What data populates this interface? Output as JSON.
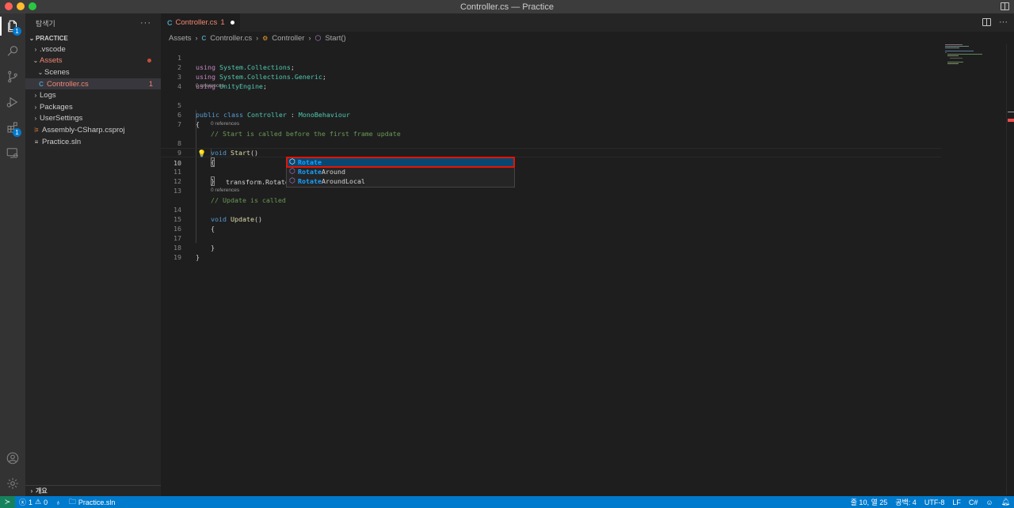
{
  "window": {
    "title": "Controller.cs — Practice"
  },
  "traffic_lights": {
    "close": "#ff5f57",
    "minimize": "#febc2e",
    "maximize": "#28c840"
  },
  "activity_bar": {
    "explorer_badge": "1",
    "extensions_badge": "1"
  },
  "sidebar": {
    "header": "탐색기",
    "more": "···",
    "section": "PRACTICE",
    "items": [
      {
        "label": ".vscode",
        "chevron": "›",
        "color": "#cccccc"
      },
      {
        "label": "Assets",
        "chevron": "⌄",
        "color": "#f48771"
      },
      {
        "label": "Scenes",
        "chevron": "⌄",
        "color": "#cccccc"
      },
      {
        "label": "Controller.cs",
        "icon": "C#",
        "color": "#f48771",
        "badge": "1"
      },
      {
        "label": "Logs",
        "chevron": "›",
        "color": "#cccccc"
      },
      {
        "label": "Packages",
        "chevron": "›",
        "color": "#cccccc"
      },
      {
        "label": "UserSettings",
        "chevron": "›",
        "color": "#cccccc"
      },
      {
        "label": "Assembly-CSharp.csproj",
        "icon": "rss",
        "color": "#cccccc"
      },
      {
        "label": "Practice.sln",
        "icon": "lines",
        "color": "#cccccc"
      }
    ],
    "outline": "개요"
  },
  "tab": {
    "label": "Controller.cs",
    "problems": "1"
  },
  "breadcrumbs": [
    "Assets",
    "Controller.cs",
    "Controller",
    "Start()"
  ],
  "editor": {
    "lines": [
      {
        "n": "1"
      },
      {
        "n": "2"
      },
      {
        "n": "3"
      },
      {
        "n": "4"
      },
      {
        "n": "5"
      },
      {
        "n": "6"
      },
      {
        "n": "7"
      },
      {
        "n": "8"
      },
      {
        "n": "9"
      },
      {
        "n": "10"
      },
      {
        "n": "11"
      },
      {
        "n": "12"
      },
      {
        "n": "13"
      },
      {
        "n": "14"
      },
      {
        "n": "15"
      },
      {
        "n": "16"
      },
      {
        "n": "17"
      },
      {
        "n": "18"
      },
      {
        "n": "19"
      }
    ],
    "code": {
      "l1_kw": "using",
      "l1_ns": "System.Collections",
      "l1_end": ";",
      "l2_kw": "using",
      "l2_ns": "System.Collections.Generic",
      "l2_end": ";",
      "l3_kw": "using",
      "l3_ns": "UnityEngine",
      "l3_end": ";",
      "lens_class": "0 references",
      "l5_kw1": "public",
      "l5_kw2": "class",
      "l5_name": "Controller",
      "l5_colon": " : ",
      "l5_base": "MonoBehaviour",
      "l6": "{",
      "l7": "// Start is called before the first frame update",
      "lens_start": "0 references",
      "l8_kw": "void",
      "l8_fn": "Start",
      "l8_end": "()",
      "l9": "{",
      "l10": "transform.Rotate",
      "l11": "}",
      "l13": "// Update is called",
      "lens_update": "0 references",
      "l14_kw": "void",
      "l14_fn": "Update",
      "l14_end": "()",
      "l15": "{",
      "l17": "}",
      "l18": "}"
    }
  },
  "suggestions": [
    {
      "match": "Rotate",
      "rest": "",
      "selected": true
    },
    {
      "match": "Rotate",
      "rest": "Around",
      "selected": false
    },
    {
      "match": "Rotate",
      "rest": "AroundLocal",
      "selected": false
    }
  ],
  "statusbar": {
    "errors": "1",
    "warnings": "0",
    "solution": "Practice.sln",
    "position": "줄 10, 열 25",
    "spaces": "공백: 4",
    "encoding": "UTF-8",
    "eol": "LF",
    "language": "C#"
  }
}
